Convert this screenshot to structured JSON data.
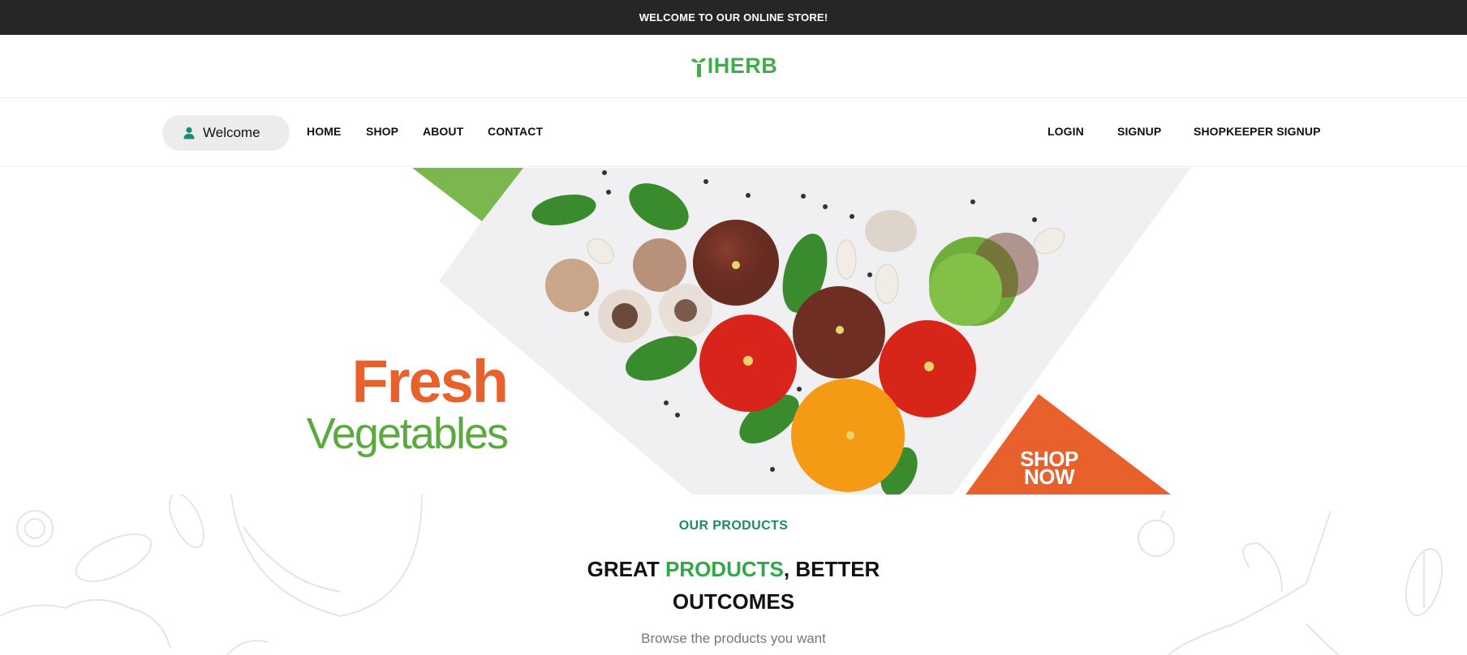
{
  "topbar": {
    "message": "WELCOME TO OUR ONLINE STORE!"
  },
  "logo": {
    "text": "IHERB",
    "icon": "leaf-icon",
    "color": "#3fae49"
  },
  "nav": {
    "welcome_label": "Welcome",
    "user_icon": "user-icon",
    "left_links": [
      "HOME",
      "SHOP",
      "ABOUT",
      "CONTACT"
    ],
    "right_links": [
      "LOGIN",
      "SIGNUP",
      "SHOPKEEPER SIGNUP"
    ]
  },
  "hero": {
    "title_line1": "Fresh",
    "title_line2": "Vegetables",
    "cta_line1": "SHOP",
    "cta_line2": "NOW",
    "colors": {
      "orange": "#e8612c",
      "green": "#5aaa3f",
      "light_green": "#7ab84f"
    }
  },
  "products_section": {
    "eyebrow": "OUR PRODUCTS",
    "headline_part1": "GREAT ",
    "headline_highlight": "PRODUCTS",
    "headline_part2": ", BETTER",
    "headline_line2": "OUTCOMES",
    "subtext": "Browse the products you want"
  }
}
